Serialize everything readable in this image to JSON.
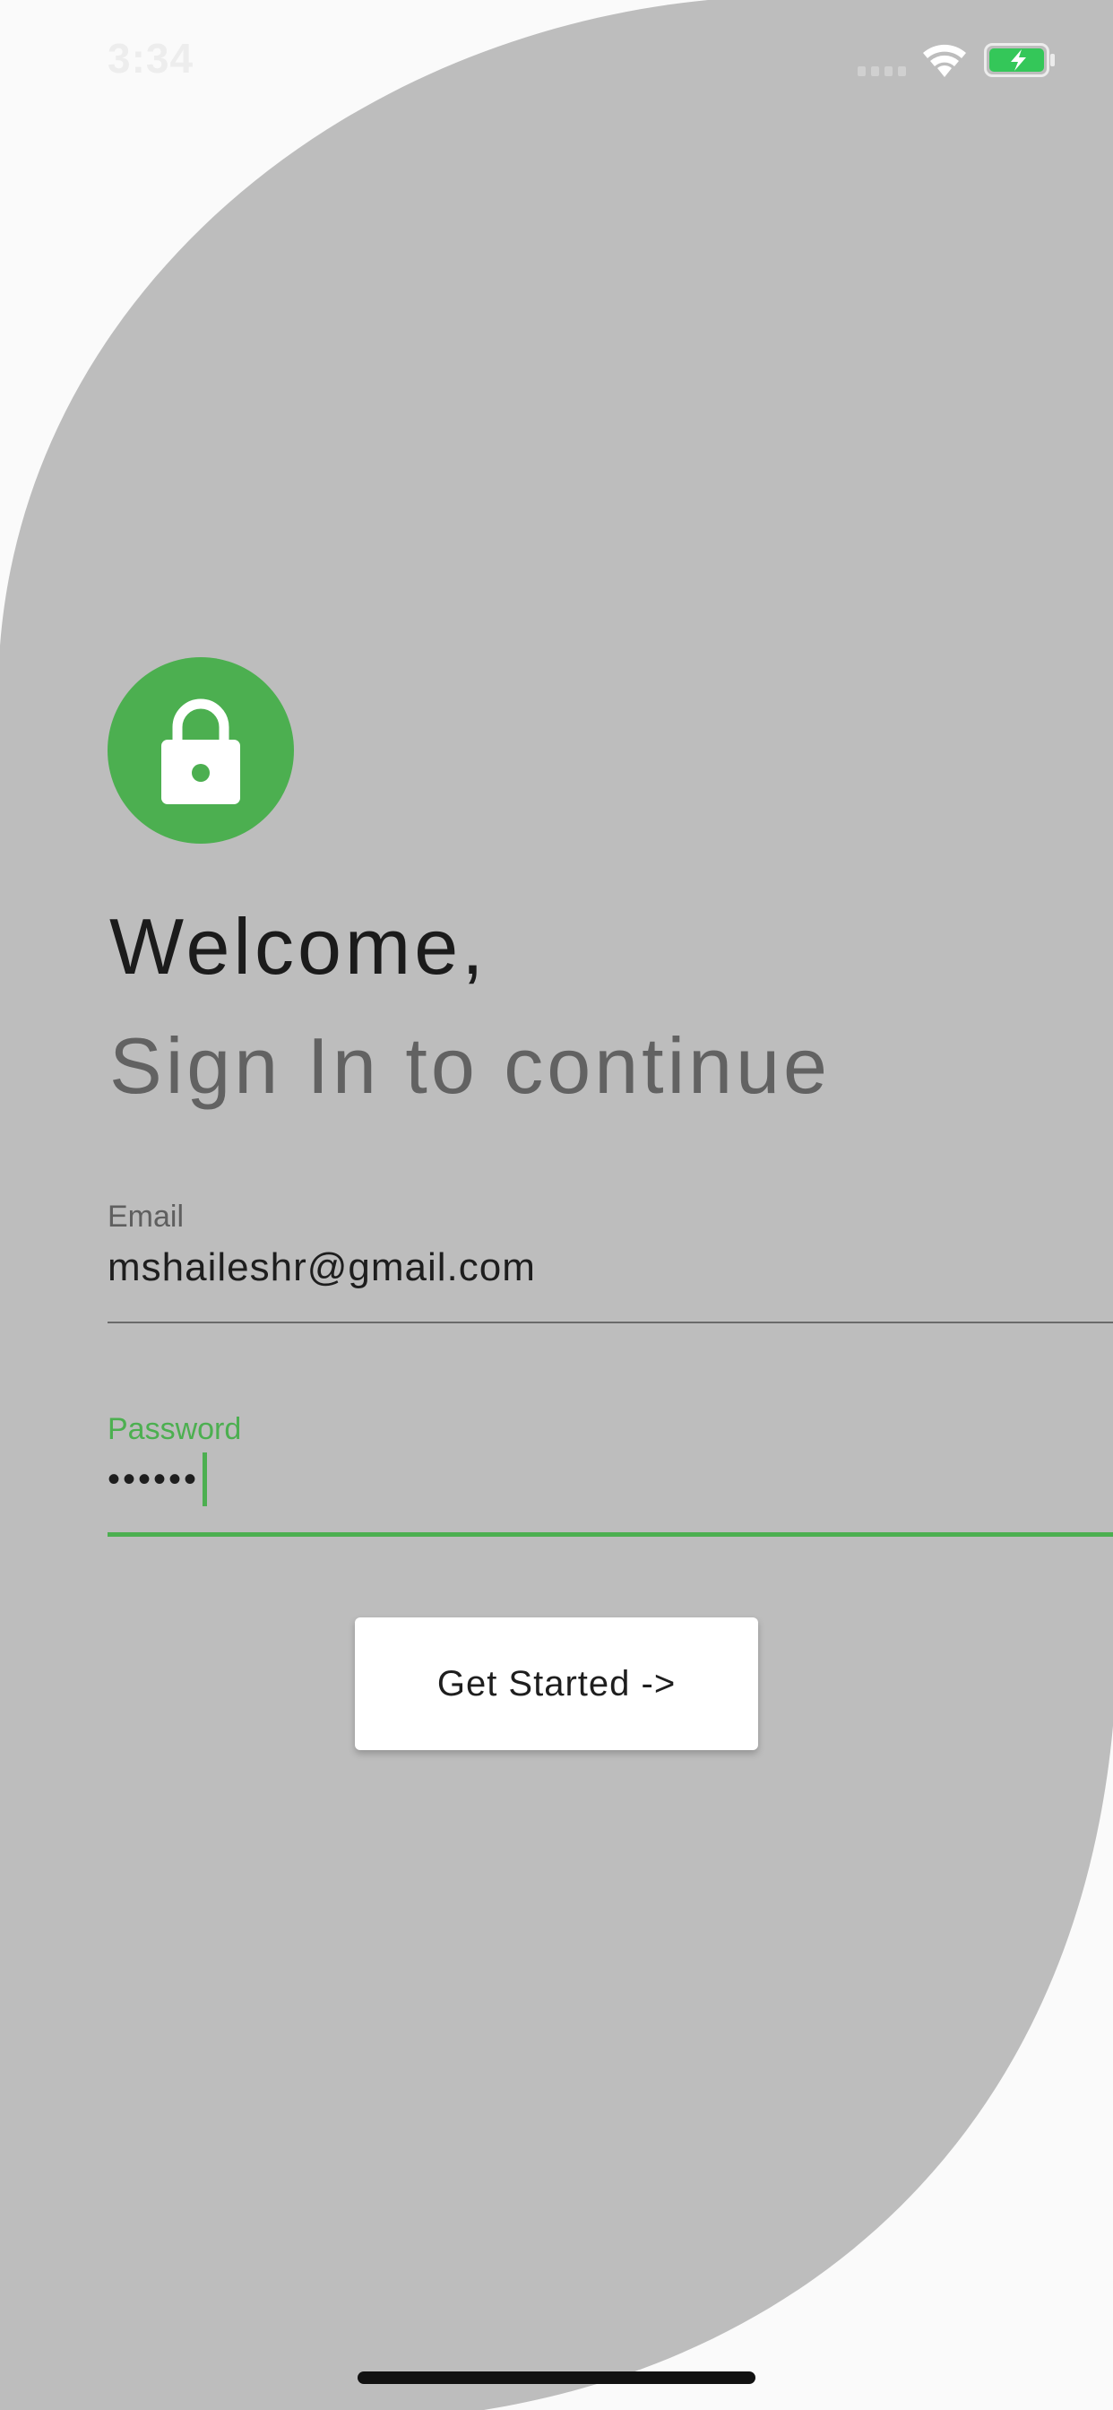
{
  "status_bar": {
    "time": "3:34",
    "wifi_icon": "wifi-icon",
    "battery_icon": "battery-charging-icon",
    "battery_color": "#34c759"
  },
  "colors": {
    "accent": "#4caf50",
    "background_shape": "#bdbdbd",
    "page_background": "#fafafa"
  },
  "header": {
    "icon": "lock-icon",
    "title": "Welcome,",
    "subtitle": "Sign In to continue"
  },
  "form": {
    "email": {
      "label": "Email",
      "value": "mshaileshr@gmail.com"
    },
    "password": {
      "label": "Password",
      "value": "••••••",
      "focused": true
    },
    "submit_label": "Get Started ->"
  }
}
